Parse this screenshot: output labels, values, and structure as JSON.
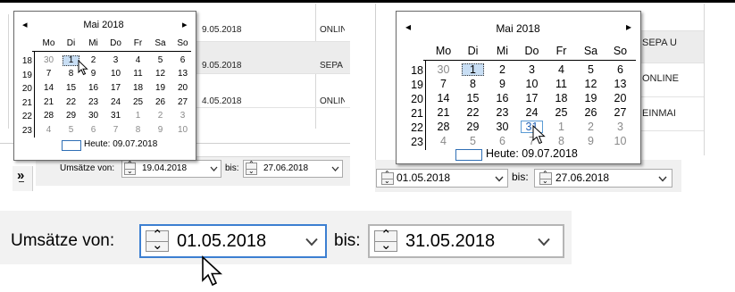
{
  "left_panel": {
    "rows": [
      {
        "date": "9.05.2018",
        "text": "ONLIN"
      },
      {
        "date": "9.05.2018",
        "text": "SEPA"
      },
      {
        "date": "4.05.2018",
        "text": "ONLIN"
      }
    ],
    "collapse_glyph": "»"
  },
  "right_panel": {
    "rows": [
      {
        "text": "SEPA U"
      },
      {
        "text": "ONLINE"
      },
      {
        "text": "EINMAI"
      }
    ]
  },
  "calendar_left": {
    "month": "Mai 2018",
    "prev_icon": "◂",
    "next_icon": "▸",
    "weekdays": [
      "Mo",
      "Di",
      "Mi",
      "Do",
      "Fr",
      "Sa",
      "So"
    ],
    "weeks": [
      {
        "wk": "18",
        "days": [
          "30",
          "1",
          "2",
          "3",
          "4",
          "5",
          "6"
        ]
      },
      {
        "wk": "19",
        "days": [
          "7",
          "8",
          "9",
          "10",
          "11",
          "12",
          "13"
        ]
      },
      {
        "wk": "20",
        "days": [
          "14",
          "15",
          "16",
          "17",
          "18",
          "19",
          "20"
        ]
      },
      {
        "wk": "21",
        "days": [
          "21",
          "22",
          "23",
          "24",
          "25",
          "26",
          "27"
        ]
      },
      {
        "wk": "22",
        "days": [
          "28",
          "29",
          "30",
          "31",
          "1",
          "2",
          "3"
        ]
      },
      {
        "wk": "23",
        "days": [
          "4",
          "5",
          "6",
          "7",
          "8",
          "9",
          "10"
        ]
      }
    ],
    "today_label": "Heute: 09.07.2018"
  },
  "calendar_right": {
    "month": "Mai 2018",
    "prev_icon": "◂",
    "next_icon": "▸",
    "weekdays": [
      "Mo",
      "Di",
      "Mi",
      "Do",
      "Fr",
      "Sa",
      "So"
    ],
    "weeks": [
      {
        "wk": "18",
        "days": [
          "30",
          "1",
          "2",
          "3",
          "4",
          "5",
          "6"
        ]
      },
      {
        "wk": "19",
        "days": [
          "7",
          "8",
          "9",
          "10",
          "11",
          "12",
          "13"
        ]
      },
      {
        "wk": "20",
        "days": [
          "14",
          "15",
          "16",
          "17",
          "18",
          "19",
          "20"
        ]
      },
      {
        "wk": "21",
        "days": [
          "21",
          "22",
          "23",
          "24",
          "25",
          "26",
          "27"
        ]
      },
      {
        "wk": "22",
        "days": [
          "28",
          "29",
          "30",
          "31",
          "1",
          "2",
          "3"
        ]
      },
      {
        "wk": "23",
        "days": [
          "4",
          "5",
          "6",
          "7",
          "8",
          "9",
          "10"
        ]
      }
    ],
    "today_label": "Heute: 09.07.2018"
  },
  "filter_small_left": {
    "from_label": "Umsätze von:",
    "from_value": "19.04.2018",
    "to_label": "bis:",
    "to_value": "27.06.2018"
  },
  "filter_small_right": {
    "from_value": "01.05.2018",
    "to_label": "bis:",
    "to_value": "27.06.2018"
  },
  "filter_large": {
    "from_label": "Umsätze von:",
    "from_value": "01.05.2018",
    "to_label": "bis:",
    "to_value": "31.05.2018"
  },
  "colors": {
    "accent_blue": "#3c7fd1",
    "selection": "#c8def4",
    "muted_day": "#8a8a8a"
  },
  "icons": {
    "dropdown": "chevron-down-icon",
    "spinner": "spinner-icon",
    "cursor": "mouse-pointer-icon"
  }
}
